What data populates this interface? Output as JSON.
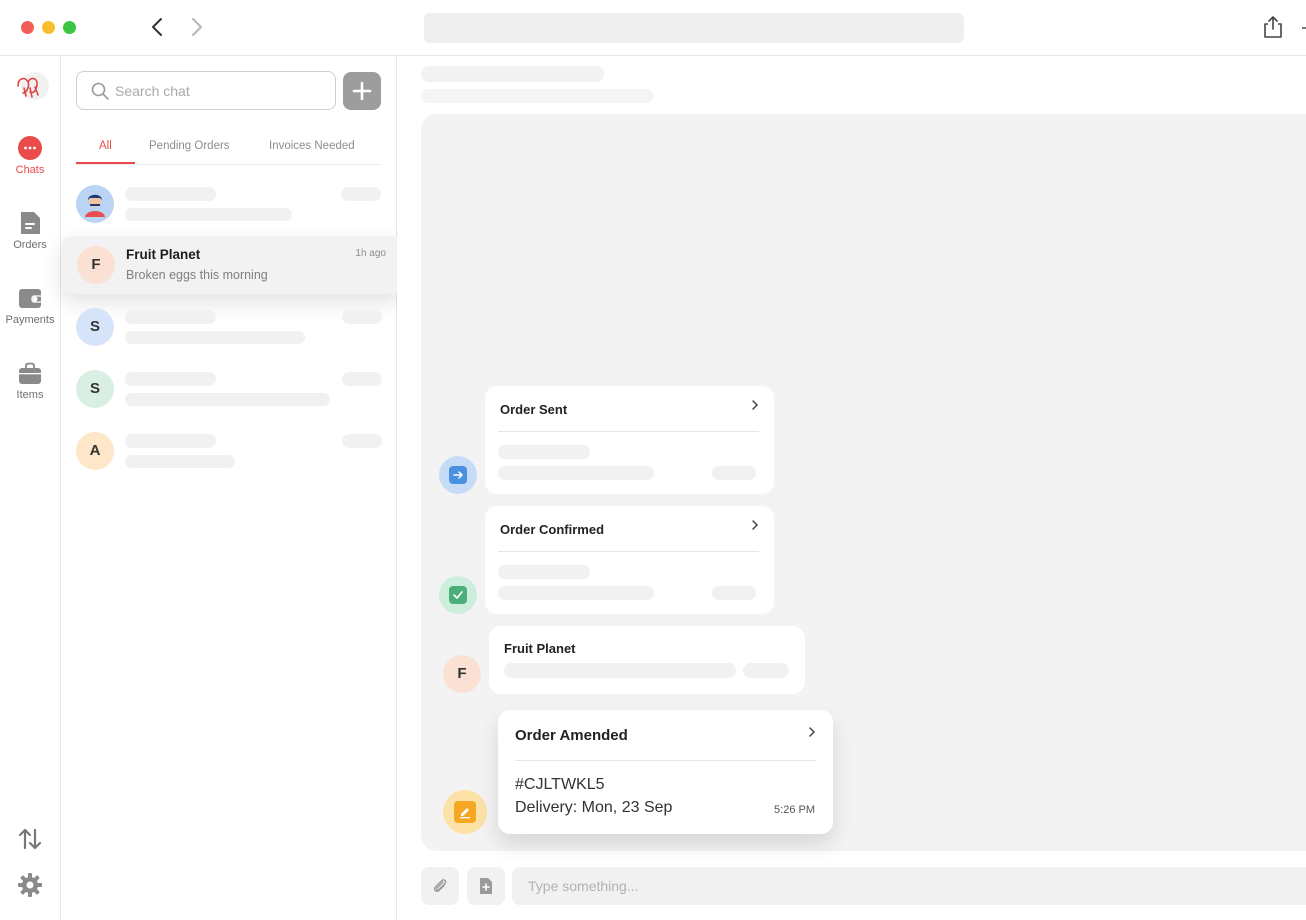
{
  "colors": {
    "accent": "#ea4a4a",
    "sent": "#4a90e2",
    "confirmed": "#4caf7a",
    "amended": "#f5a623"
  },
  "sidebar": {
    "items": [
      {
        "label": "Chats",
        "icon": "chat-bubble-icon"
      },
      {
        "label": "Orders",
        "icon": "document-icon"
      },
      {
        "label": "Payments",
        "icon": "wallet-icon"
      },
      {
        "label": "Items",
        "icon": "bag-icon"
      }
    ]
  },
  "chatlist": {
    "search_placeholder": "Search chat",
    "tabs": [
      "All",
      "Pending Orders",
      "Invoices Needed"
    ],
    "selected": {
      "avatar": "F",
      "name": "Fruit Planet",
      "preview": "Broken eggs this morning",
      "time": "1h ago"
    },
    "avatars": [
      "S",
      "S",
      "A"
    ]
  },
  "messages": {
    "order_sent": {
      "title": "Order Sent"
    },
    "order_confirmed": {
      "title": "Order Confirmed"
    },
    "fruit_message": {
      "sender": "Fruit Planet",
      "avatar": "F"
    },
    "order_amended": {
      "title": "Order Amended",
      "ref": "#CJLTWKL5",
      "delivery": "Delivery: Mon, 23 Sep",
      "time": "5:26 PM"
    }
  },
  "composer": {
    "placeholder": "Type something..."
  }
}
